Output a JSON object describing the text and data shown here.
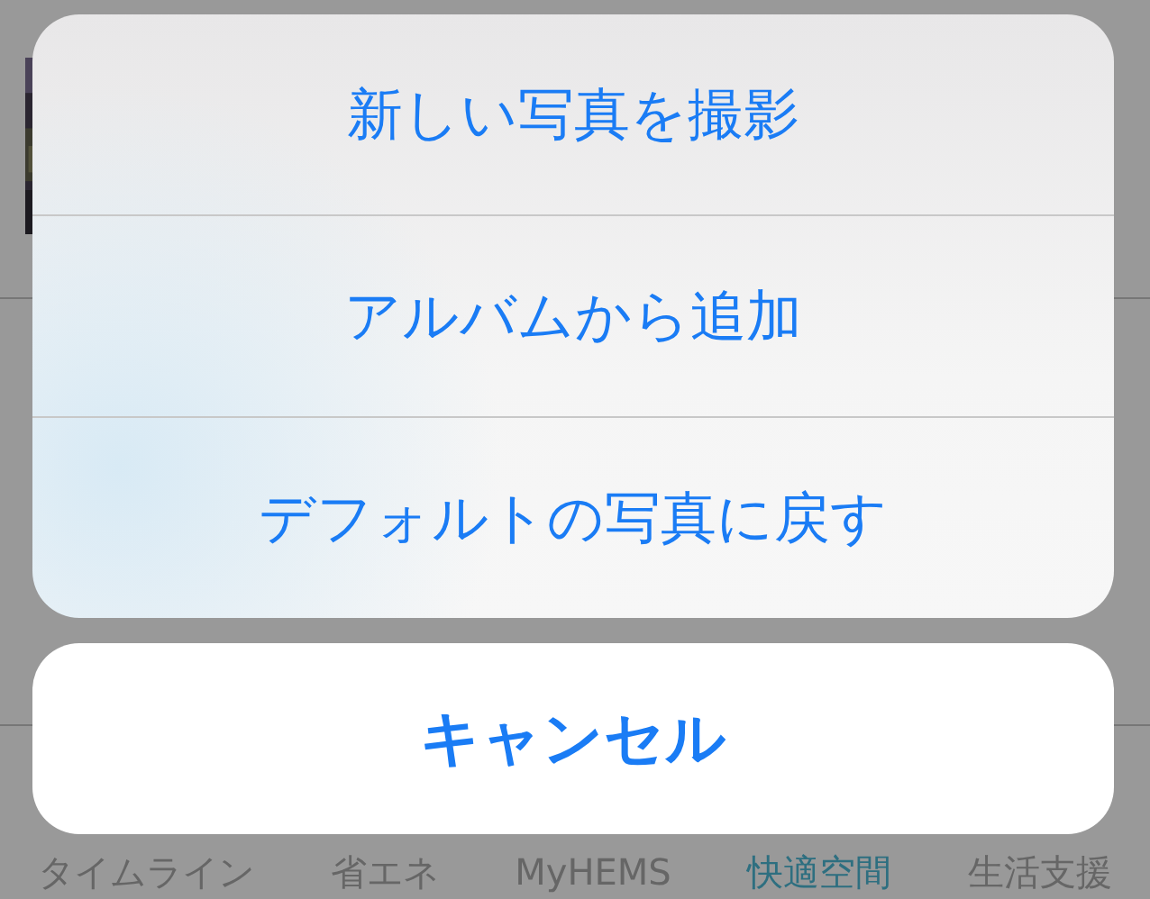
{
  "action_sheet": {
    "actions": [
      {
        "label": "新しい写真を撮影"
      },
      {
        "label": "アルバムから追加"
      },
      {
        "label": "デフォルトの写真に戻す"
      }
    ],
    "cancel": {
      "label": "キャンセル"
    }
  },
  "tab_bar": {
    "tabs": [
      {
        "label": "タイムライン",
        "selected": false
      },
      {
        "label": "省エネ",
        "selected": false
      },
      {
        "label": "MyHEMS",
        "selected": false
      },
      {
        "label": "快適空間",
        "selected": true
      },
      {
        "label": "生活支援",
        "selected": false
      }
    ]
  }
}
